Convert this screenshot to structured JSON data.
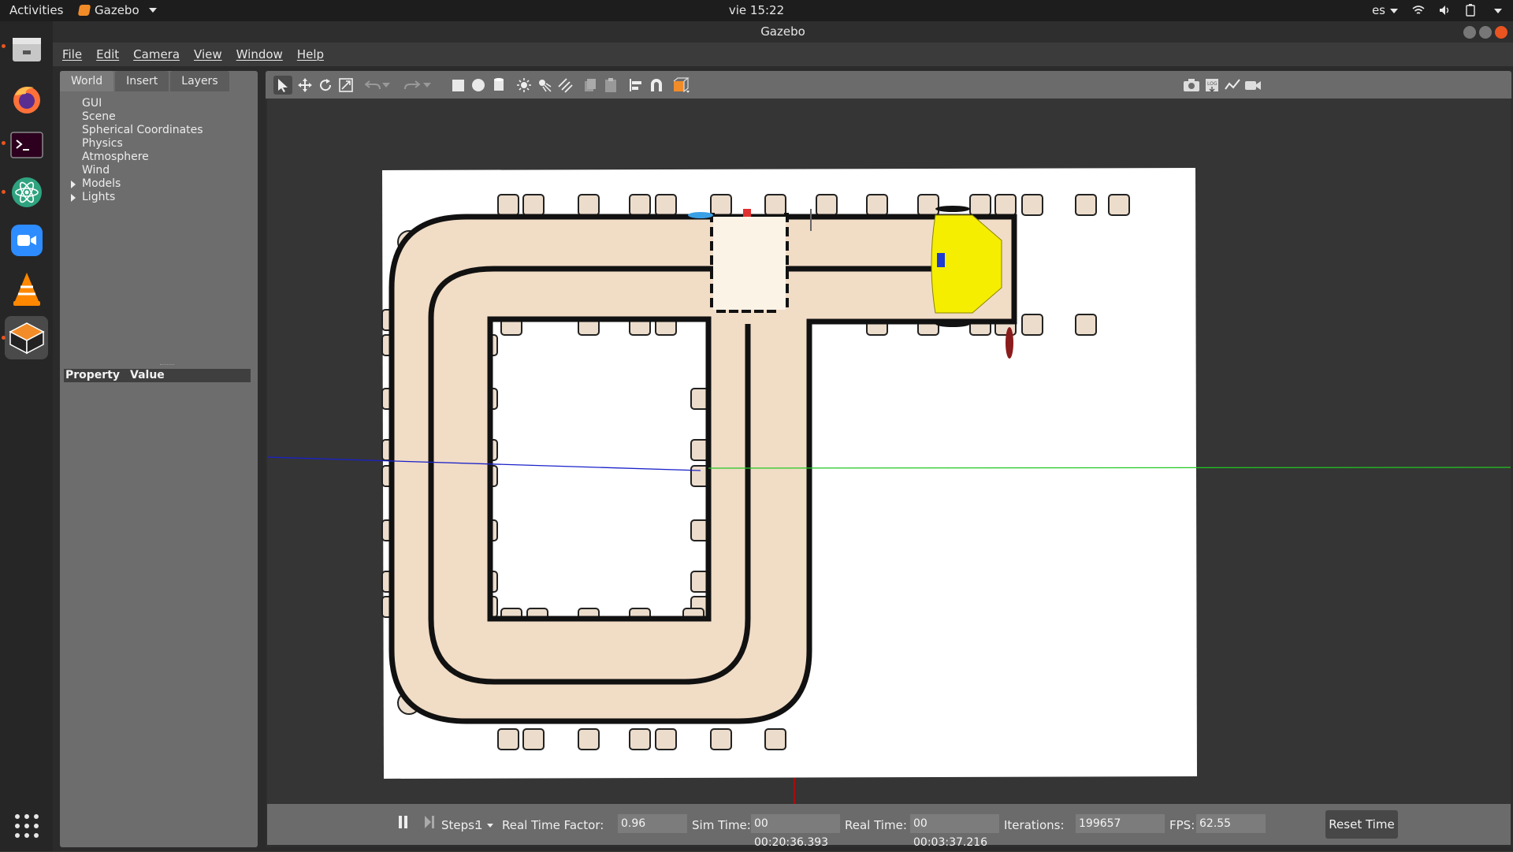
{
  "topbar": {
    "activities": "Activities",
    "app_name": "Gazebo",
    "clock": "vie 15:22",
    "keyboard_layout": "es"
  },
  "dock": {
    "items": [
      {
        "name": "files-icon"
      },
      {
        "name": "firefox-icon"
      },
      {
        "name": "terminal-icon"
      },
      {
        "name": "atom-icon"
      },
      {
        "name": "zoom-icon"
      },
      {
        "name": "vlc-icon"
      },
      {
        "name": "gazebo-icon"
      },
      {
        "name": "show-applications-icon"
      }
    ]
  },
  "window": {
    "title": "Gazebo",
    "menu": [
      "File",
      "Edit",
      "Camera",
      "View",
      "Window",
      "Help"
    ]
  },
  "left_panel": {
    "tabs": [
      "World",
      "Insert",
      "Layers"
    ],
    "tree": [
      "GUI",
      "Scene",
      "Spherical Coordinates",
      "Physics",
      "Atmosphere",
      "Wind",
      "Models",
      "Lights"
    ],
    "property_header": "Property",
    "value_header": "Value"
  },
  "bottom_bar": {
    "steps_label": "Steps:",
    "steps_value": "1",
    "rtf_label": "Real Time Factor:",
    "rtf_value": "0.96",
    "sim_time_label": "Sim Time:",
    "sim_time_value": "00 00:20:36.393",
    "real_time_label": "Real Time:",
    "real_time_value": "00 00:03:37.216",
    "iterations_label": "Iterations:",
    "iterations_value": "199657",
    "fps_label": "FPS:",
    "fps_value": "62.55",
    "reset_time": "Reset Time"
  },
  "colors": {
    "track_fill": "#f1dcc6",
    "track_line": "#111111",
    "robot_body": "#f5ee00",
    "accent_orange": "#e95420"
  }
}
